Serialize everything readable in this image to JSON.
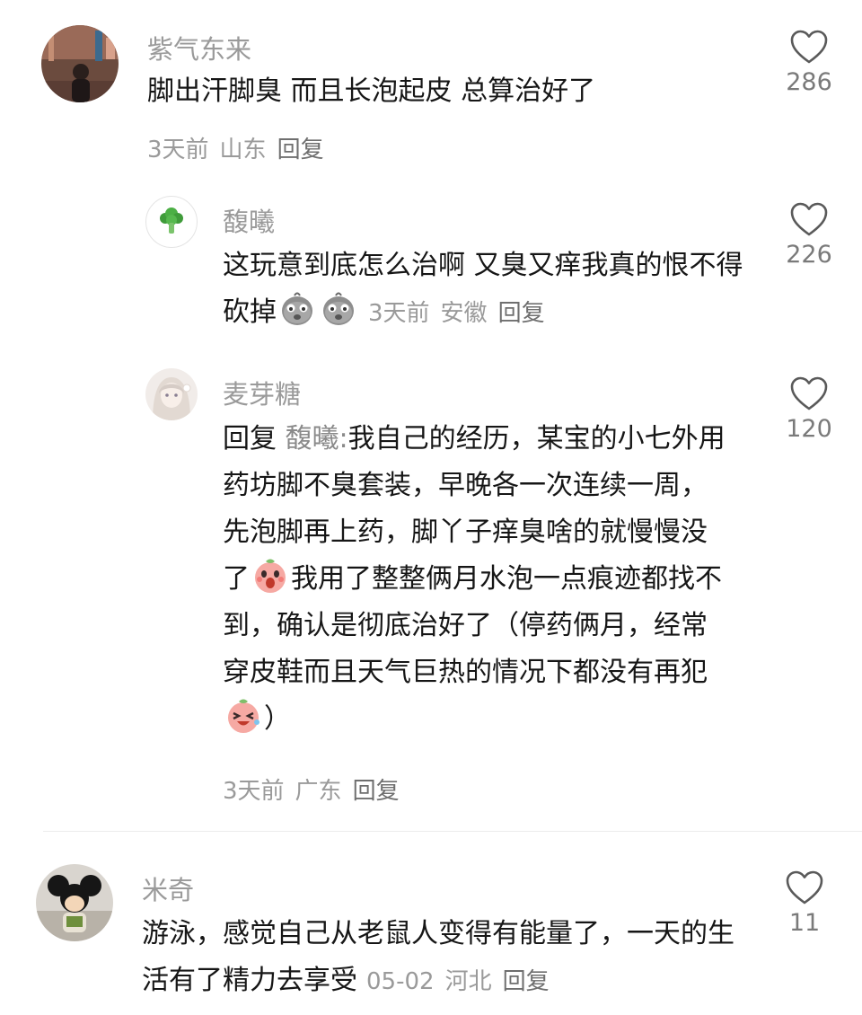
{
  "comments": [
    {
      "user": "紫气东来",
      "text": "脚出汗脚臭 而且长泡起皮 总算治好了",
      "time": "3天前",
      "location": "山东",
      "reply_label": "回复",
      "likes": "286"
    },
    {
      "user": "馥曦",
      "text": "这玩意到底怎么治啊 又臭又痒我真的恨不得砍掉",
      "time": "3天前",
      "location": "安徽",
      "reply_label": "回复",
      "likes": "226",
      "emojis": [
        "crying-potato-emoji",
        "crying-potato-emoji"
      ]
    },
    {
      "user": "麦芽糖",
      "reply_prefix": "回复",
      "mention": "馥曦:",
      "text_a": "我自己的经历，某宝的小七外用药坊脚不臭套装，早晚各一次连续一周，先泡脚再上药，脚丫子痒臭啥的就慢慢没了",
      "text_b": "我用了整整俩月水泡一点痕迹都找不到，确认是彻底治好了（停药俩月，经常穿皮鞋而且天气巨热的情况下都没有再犯",
      "text_c": "）",
      "time": "3天前",
      "location": "广东",
      "reply_label": "回复",
      "likes": "120",
      "emojis": [
        "shocked-peach-emoji",
        "laughing-peach-emoji"
      ]
    },
    {
      "user": "米奇",
      "text": "游泳，感觉自己从老鼠人变得有能量了，一天的生活有了精力去享受",
      "time": "05-02",
      "location": "河北",
      "reply_label": "回复",
      "likes": "11"
    }
  ],
  "colors": {
    "name": "#9a9a9a",
    "text": "#161616",
    "meta": "#9a9a9a",
    "like_count": "#7a7a7a"
  },
  "icons": [
    "heart-outline-icon",
    "broccoli-avatar-icon"
  ]
}
